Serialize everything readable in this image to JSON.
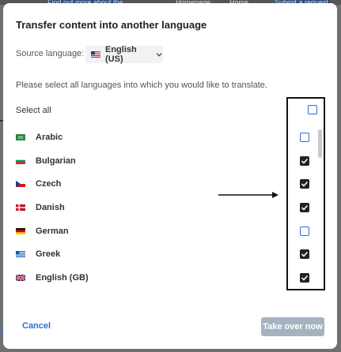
{
  "background_links": {
    "link1": "Find out more about the new modules",
    "link2": "Homepage",
    "link3": "Home",
    "link4": "Submit a request"
  },
  "dialog": {
    "title": "Transfer content into another language",
    "source_label": "Source language:",
    "source_value": "English (US)",
    "instruction": "Please select all languages into which you would like to translate.",
    "select_all_label": "Select all",
    "select_all_checked": false,
    "languages": [
      {
        "name": "Arabic",
        "flag": "arabic-flag-icon",
        "checked": false
      },
      {
        "name": "Bulgarian",
        "flag": "bulgarian-flag-icon",
        "checked": true
      },
      {
        "name": "Czech",
        "flag": "czech-flag-icon",
        "checked": true
      },
      {
        "name": "Danish",
        "flag": "danish-flag-icon",
        "checked": true
      },
      {
        "name": "German",
        "flag": "german-flag-icon",
        "checked": false
      },
      {
        "name": "Greek",
        "flag": "greek-flag-icon",
        "checked": true
      },
      {
        "name": "English (GB)",
        "flag": "uk-flag-icon",
        "checked": true
      }
    ],
    "cancel_label": "Cancel",
    "takeover_label": "Take over now"
  },
  "colors": {
    "accent": "#2f6fd6",
    "checked": "#222222",
    "disabled_button": "#a7b2c1",
    "overlay": "#6f6f6f"
  }
}
